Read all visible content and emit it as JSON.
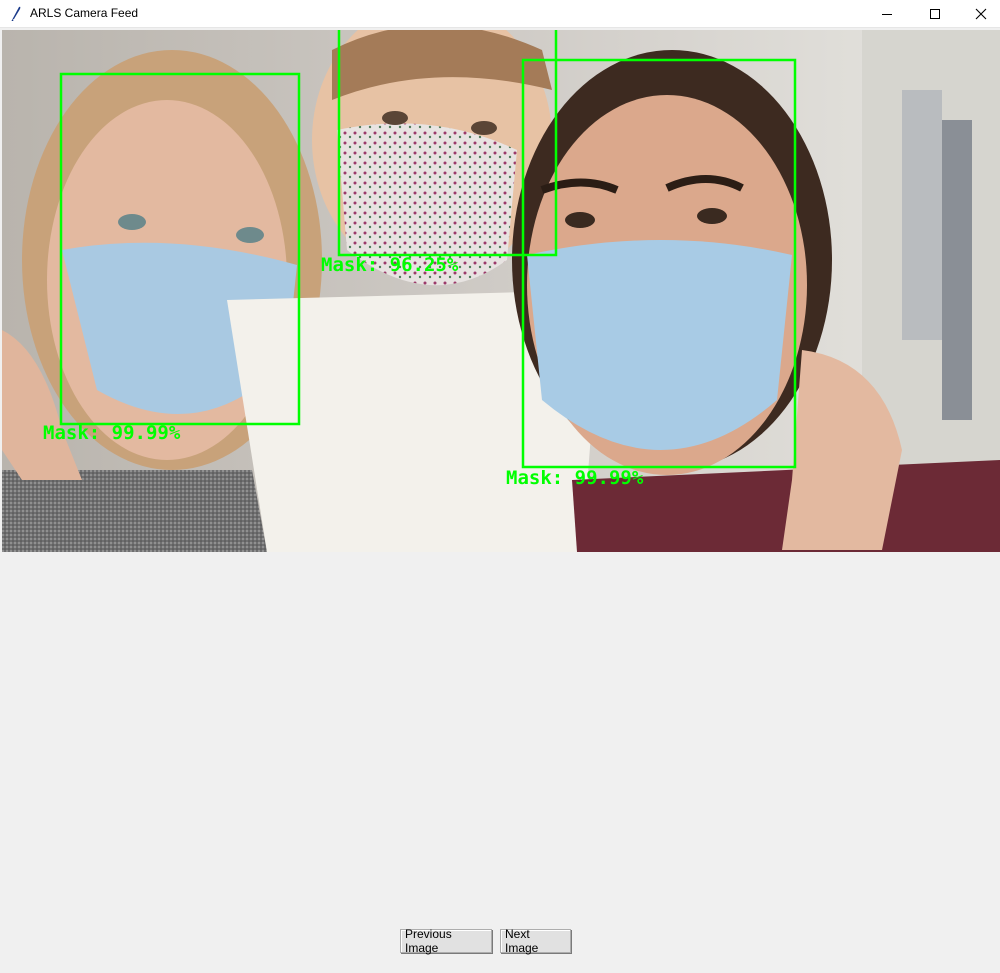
{
  "window": {
    "title": "ARLS Camera Feed",
    "controls": {
      "minimize": "minimize-icon",
      "maximize": "maximize-icon",
      "close": "close-icon"
    }
  },
  "feed": {
    "box_color": "#00ff00",
    "detections": [
      {
        "label": "Mask: 99.99%"
      },
      {
        "label": "Mask: 96.25%"
      },
      {
        "label": "Mask: 99.99%"
      }
    ]
  },
  "controls": {
    "previous_label": "Previous Image",
    "next_label": "Next Image"
  }
}
